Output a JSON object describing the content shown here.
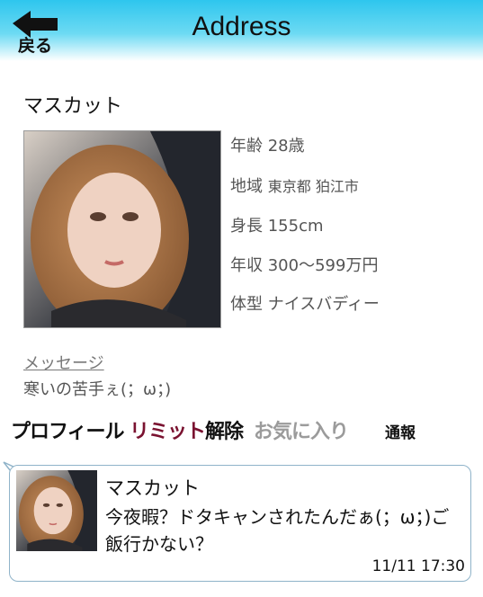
{
  "header": {
    "back_label": "戻る",
    "title": "Address",
    "gradient_colors": [
      "#2ec6ee",
      "#ffffff"
    ]
  },
  "profile": {
    "name": "マスカット",
    "photo_icon": "profile-photo",
    "info": [
      {
        "label": "年齢",
        "value": "28歳"
      },
      {
        "label": "地域",
        "value": "東京都 狛江市"
      },
      {
        "label": "身長",
        "value": "155cm"
      },
      {
        "label": "年収",
        "value": "300〜599万円"
      },
      {
        "label": "体型",
        "value": "ナイスバディー"
      }
    ],
    "message_label": "メッセージ",
    "message": "寒いの苦手ぇ(；ω；)"
  },
  "tabs": {
    "profile": "プロフィール",
    "limit_part1": "リミット",
    "limit_part2": "解除",
    "favorite": "お気に入り",
    "report": "通報",
    "limit_color": "#7a1230"
  },
  "chat": {
    "name": "マスカット",
    "text": "今夜暇？ドタキャンされたんだぁ(；ω；)ご飯行かない？",
    "time": "11/11 17:30",
    "border_color": "#8fb3c9"
  }
}
